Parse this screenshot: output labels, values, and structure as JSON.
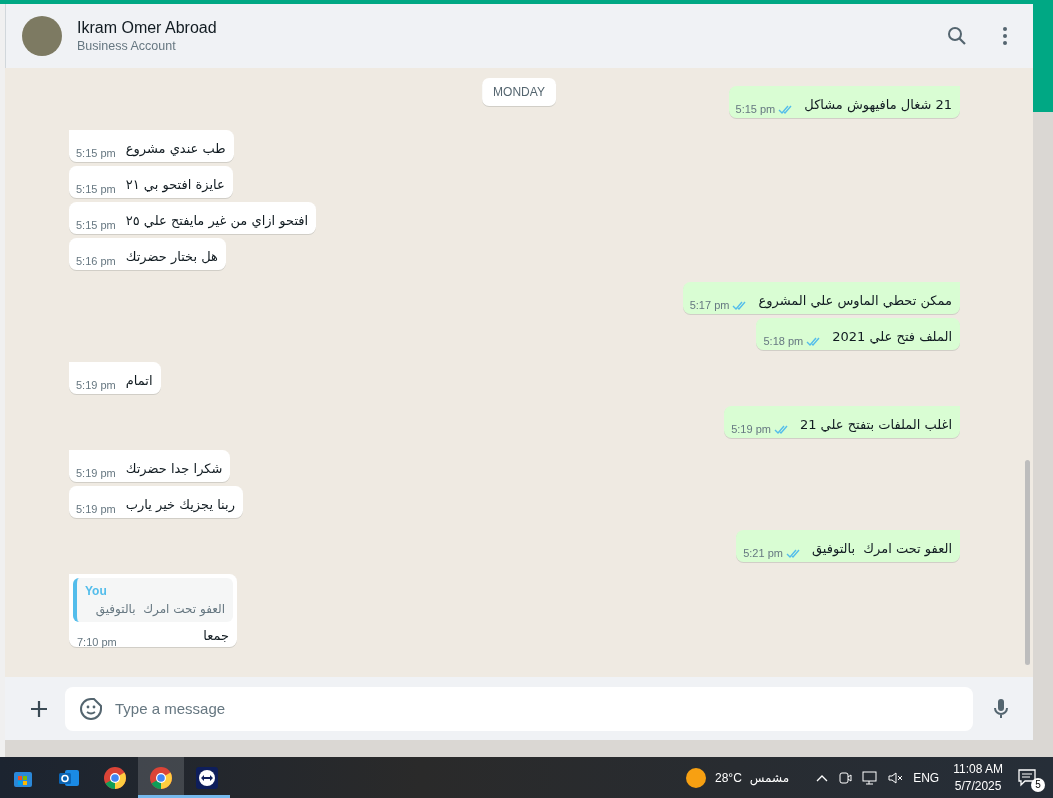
{
  "header": {
    "title": "Ikram Omer Abroad",
    "subtitle": "Business Account"
  },
  "date_chip": "MONDAY",
  "messages": [
    {
      "kind": "out",
      "group_start": true,
      "text": "21 شغال مافيهوش مشاكل",
      "time": "5:15 pm",
      "read": true
    },
    {
      "kind": "in",
      "group_start": true,
      "text": "طب عندي مشروع",
      "time": "5:15 pm"
    },
    {
      "kind": "in",
      "group_start": false,
      "text": "عايزة افتحو بي ٢١",
      "time": "5:15 pm"
    },
    {
      "kind": "in",
      "group_start": false,
      "text": "افتحو ازاي من غير مايفتح علي ٢٥",
      "time": "5:15 pm"
    },
    {
      "kind": "in",
      "group_start": false,
      "text": "هل بختار حضرتك",
      "time": "5:16 pm"
    },
    {
      "kind": "out",
      "group_start": true,
      "text": "ممكن تحطي الماوس علي المشروع",
      "time": "5:17 pm",
      "read": true
    },
    {
      "kind": "out",
      "group_start": false,
      "text": "الملف فتح علي 2021",
      "time": "5:18 pm",
      "read": true
    },
    {
      "kind": "in",
      "group_start": true,
      "text": "اتمام",
      "time": "5:19 pm"
    },
    {
      "kind": "out",
      "group_start": true,
      "text": "اغلب الملفات بتفتح علي 21",
      "time": "5:19 pm",
      "read": true
    },
    {
      "kind": "in",
      "group_start": true,
      "text": "شكرا جدا حضرتك",
      "time": "5:19 pm"
    },
    {
      "kind": "in",
      "group_start": false,
      "text": "ربنا يجزيك خير يارب",
      "time": "5:19 pm"
    },
    {
      "kind": "out",
      "group_start": true,
      "text": "العفو تحت امرك  بالتوفيق",
      "time": "5:21 pm",
      "read": true
    },
    {
      "kind": "in",
      "group_start": true,
      "text": "جمعا",
      "time": "7:10 pm",
      "quote": {
        "author": "You",
        "text": "العفو تحت امرك  بالتوفيق"
      }
    }
  ],
  "composer": {
    "placeholder": "Type a message"
  },
  "taskbar": {
    "apps": [
      {
        "kind": "store",
        "selected": false,
        "running": false
      },
      {
        "kind": "mail",
        "selected": false,
        "running": false
      },
      {
        "kind": "browser",
        "selected": false,
        "running": false
      },
      {
        "kind": "browser",
        "selected": true,
        "running": true
      },
      {
        "kind": "remote",
        "selected": false,
        "running": true
      }
    ],
    "weather": {
      "temperature": "28°C",
      "condition": "مشمس"
    },
    "language": "ENG",
    "time": "11:08 AM",
    "date": "5/7/2025",
    "notifications": "5"
  }
}
